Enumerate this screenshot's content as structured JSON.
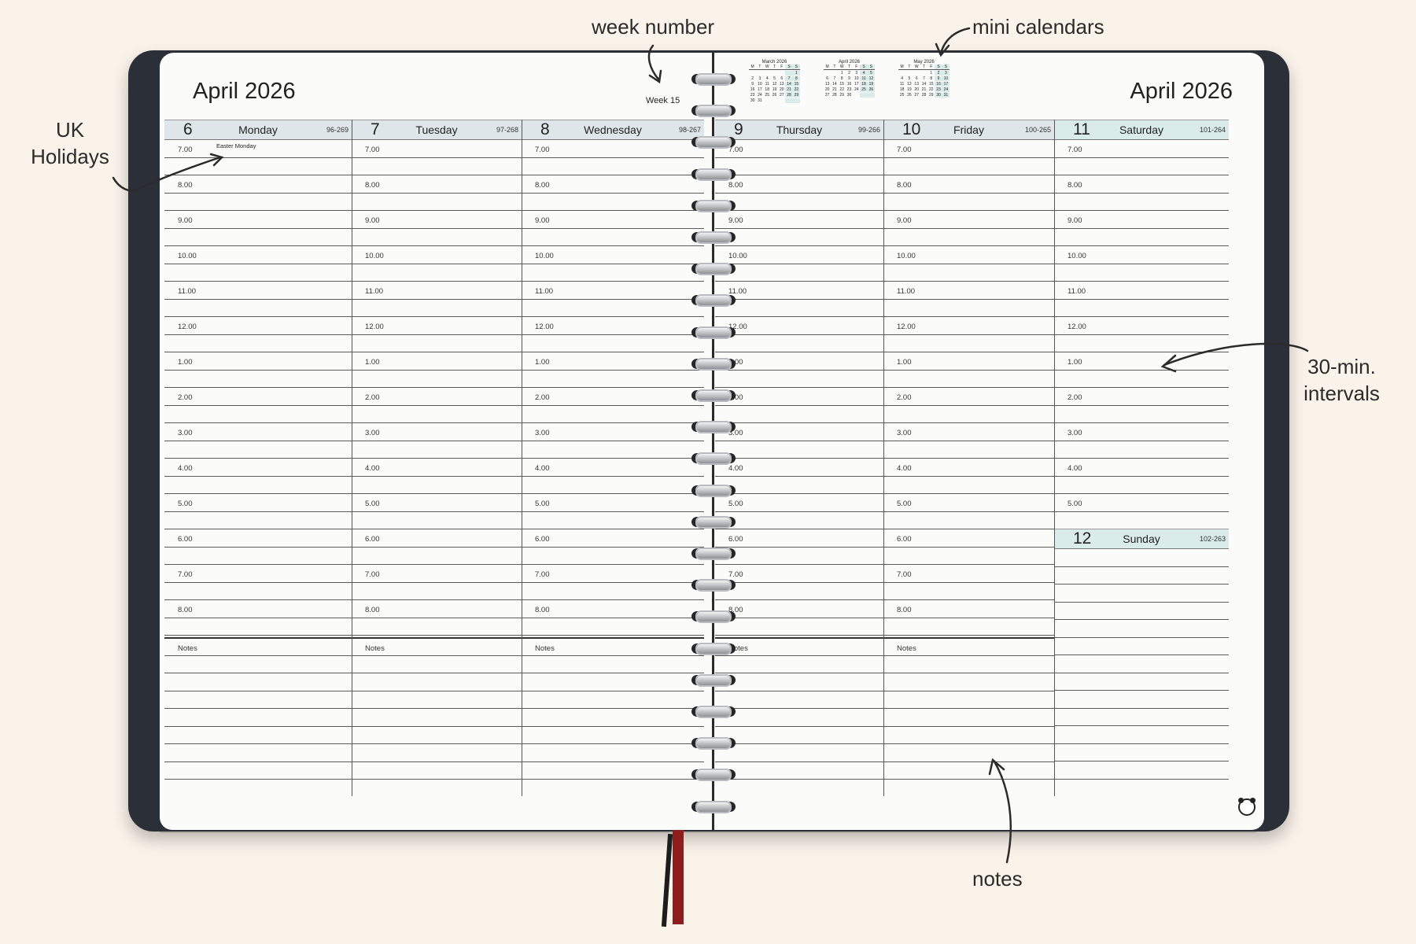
{
  "month_title": "April 2026",
  "week_label": "Week 15",
  "holiday": "Easter Monday",
  "notes_label": "Notes",
  "days_left": [
    {
      "num": "6",
      "name": "Monday",
      "code": "96-269"
    },
    {
      "num": "7",
      "name": "Tuesday",
      "code": "97-268"
    },
    {
      "num": "8",
      "name": "Wednesday",
      "code": "98-267"
    }
  ],
  "days_right": [
    {
      "num": "9",
      "name": "Thursday",
      "code": "99-266"
    },
    {
      "num": "10",
      "name": "Friday",
      "code": "100-265"
    },
    {
      "num": "11",
      "name": "Saturday",
      "code": "101-264"
    }
  ],
  "sunday": {
    "num": "12",
    "name": "Sunday",
    "code": "102-263"
  },
  "times": [
    "7.00",
    "8.00",
    "9.00",
    "10.00",
    "11.00",
    "12.00",
    "1.00",
    "2.00",
    "3.00",
    "4.00",
    "5.00",
    "6.00",
    "7.00",
    "8.00"
  ],
  "saturday_times": [
    "7.00",
    "8.00",
    "9.00",
    "10.00",
    "11.00",
    "12.00",
    "1.00",
    "2.00",
    "3.00",
    "4.00",
    "5.00"
  ],
  "mini_calendars": [
    {
      "title": "March 2026",
      "weekdays": [
        "M",
        "T",
        "W",
        "T",
        "F",
        "S",
        "S"
      ],
      "cells": [
        "",
        "",
        "",
        "",
        "",
        "",
        "1",
        "2",
        "3",
        "4",
        "5",
        "6",
        "7",
        "8",
        "9",
        "10",
        "11",
        "12",
        "13",
        "14",
        "15",
        "16",
        "17",
        "18",
        "19",
        "20",
        "21",
        "22",
        "23",
        "24",
        "25",
        "26",
        "27",
        "28",
        "29",
        "30",
        "31",
        "",
        "",
        "",
        "",
        ""
      ]
    },
    {
      "title": "April 2026",
      "weekdays": [
        "M",
        "T",
        "W",
        "T",
        "F",
        "S",
        "S"
      ],
      "cells": [
        "",
        "",
        "1",
        "2",
        "3",
        "4",
        "5",
        "6",
        "7",
        "8",
        "9",
        "10",
        "11",
        "12",
        "13",
        "14",
        "15",
        "16",
        "17",
        "18",
        "19",
        "20",
        "21",
        "22",
        "23",
        "24",
        "25",
        "26",
        "27",
        "28",
        "29",
        "30",
        "",
        "",
        ""
      ]
    },
    {
      "title": "May 2026",
      "weekdays": [
        "M",
        "T",
        "W",
        "T",
        "F",
        "S",
        "S"
      ],
      "cells": [
        "",
        "",
        "",
        "",
        "1",
        "2",
        "3",
        "4",
        "5",
        "6",
        "7",
        "8",
        "9",
        "10",
        "11",
        "12",
        "13",
        "14",
        "15",
        "16",
        "17",
        "18",
        "19",
        "20",
        "21",
        "22",
        "23",
        "24",
        "25",
        "26",
        "27",
        "28",
        "29",
        "30",
        "31"
      ]
    }
  ],
  "annotations": {
    "week_number": "week number",
    "mini_calendars": "mini calendars",
    "uk_holidays_line1": "UK",
    "uk_holidays_line2": "Holidays",
    "intervals_line1": "30-min.",
    "intervals_line2": "intervals",
    "notes": "notes"
  },
  "colors": {
    "cover": "#2b3038",
    "page": "#fbfbfa",
    "header": "#dfe6ea",
    "accent_teal": "#d9ece9",
    "bookmark": "#8e1d1d"
  }
}
